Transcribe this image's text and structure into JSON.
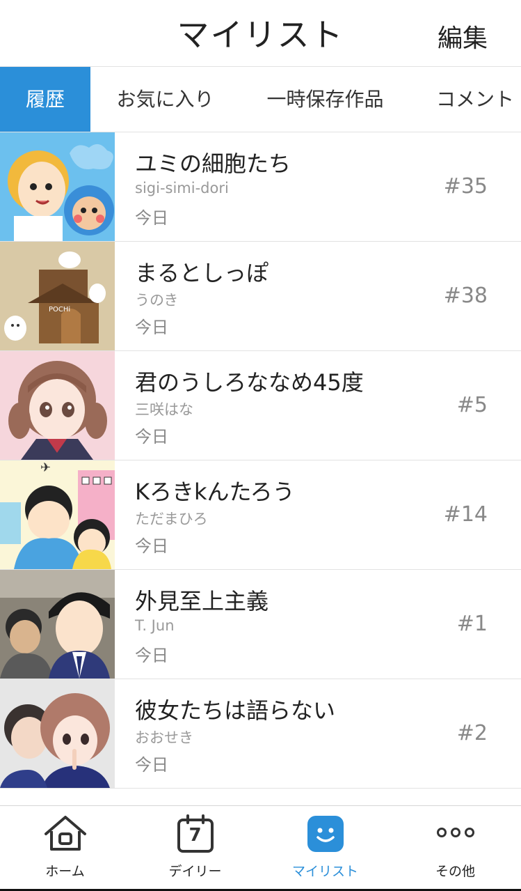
{
  "header": {
    "title": "マイリスト",
    "edit_label": "編集"
  },
  "tabs": [
    {
      "label": "履歴",
      "active": true
    },
    {
      "label": "お気に入り",
      "active": false
    },
    {
      "label": "一時保存作品",
      "active": false
    },
    {
      "label": "コメント",
      "active": false
    }
  ],
  "items": [
    {
      "title": "ユミの細胞たち",
      "author": "sigi-simi-dori",
      "date": "今日",
      "episode": "#35"
    },
    {
      "title": "まるとしっぽ",
      "author": "うのき",
      "date": "今日",
      "episode": "#38"
    },
    {
      "title": "君のうしろななめ45度",
      "author": "三咲はな",
      "date": "今日",
      "episode": "#5"
    },
    {
      "title": "Kろきkんたろう",
      "author": "ただまひろ",
      "date": "今日",
      "episode": "#14"
    },
    {
      "title": "外見至上主義",
      "author": "T. Jun",
      "date": "今日",
      "episode": "#1"
    },
    {
      "title": "彼女たちは語らない",
      "author": "おおせき",
      "date": "今日",
      "episode": "#2"
    }
  ],
  "bottom_nav": [
    {
      "label": "ホーム",
      "icon": "home-icon",
      "active": false
    },
    {
      "label": "デイリー",
      "icon": "calendar-icon",
      "calendar_day": "7",
      "active": false
    },
    {
      "label": "マイリスト",
      "icon": "smile-icon",
      "active": true
    },
    {
      "label": "その他",
      "icon": "more-icon",
      "active": false
    }
  ],
  "colors": {
    "accent": "#2b8fd9",
    "text": "#222222",
    "muted": "#888888"
  }
}
